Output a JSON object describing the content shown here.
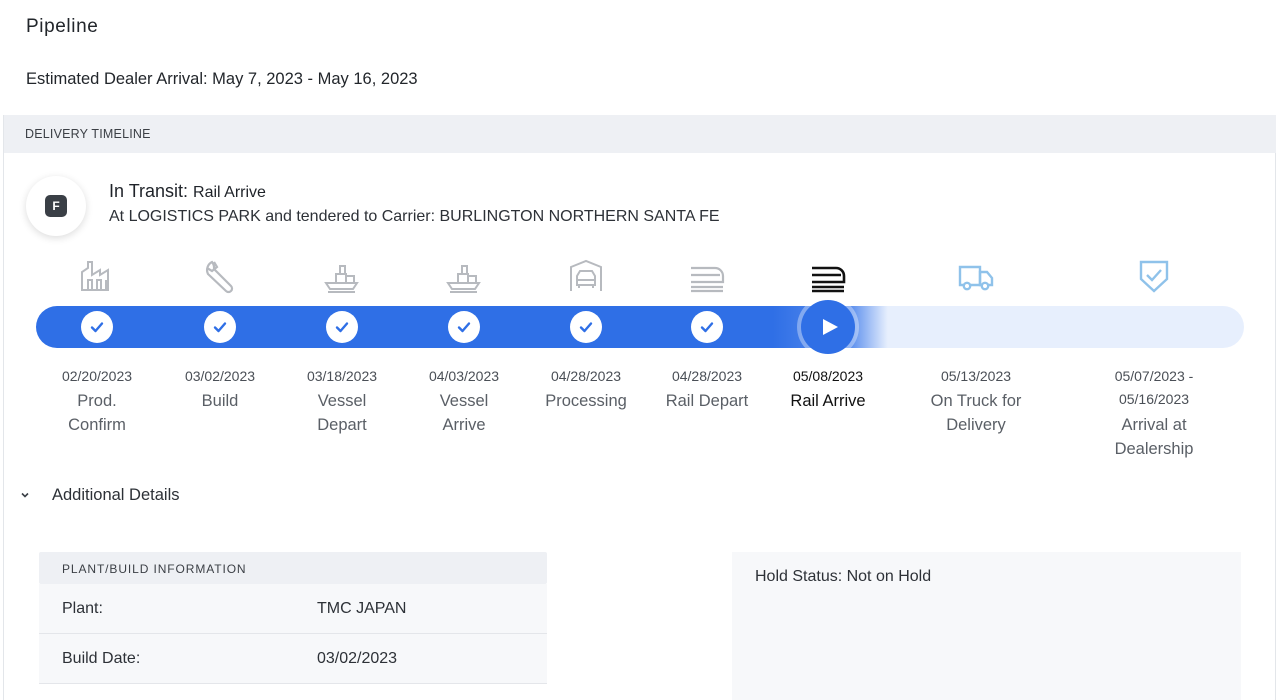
{
  "page": {
    "title": "Pipeline",
    "eta_text": "Estimated Dealer Arrival: May 7, 2023 - May 16, 2023"
  },
  "timeline": {
    "section_title": "DELIVERY TIMELINE",
    "avatar_letter": "F",
    "status_prefix": "In Transit:",
    "status_value": "Rail Arrive",
    "status_detail": "At LOGISTICS PARK and tendered to Carrier: BURLINGTON NORTHERN SANTA FE",
    "steps": [
      {
        "date": "02/20/2023",
        "label": "Prod. Confirm",
        "icon": "factory-icon",
        "state": "done"
      },
      {
        "date": "03/02/2023",
        "label": "Build",
        "icon": "wrench-icon",
        "state": "done"
      },
      {
        "date": "03/18/2023",
        "label": "Vessel Depart",
        "icon": "ship-icon",
        "state": "done"
      },
      {
        "date": "04/03/2023",
        "label": "Vessel Arrive",
        "icon": "ship-icon",
        "state": "done"
      },
      {
        "date": "04/28/2023",
        "label": "Processing",
        "icon": "car-lift-icon",
        "state": "done"
      },
      {
        "date": "04/28/2023",
        "label": "Rail Depart",
        "icon": "train-icon",
        "state": "done"
      },
      {
        "date": "05/08/2023",
        "label": "Rail Arrive",
        "icon": "train-icon",
        "state": "current"
      },
      {
        "date": "05/13/2023",
        "label": "On Truck for Delivery",
        "icon": "truck-icon",
        "state": "pending"
      },
      {
        "date": "05/07/2023 - 05/16/2023",
        "label": "Arrival at Dealership",
        "icon": "shield-check-icon",
        "state": "pending"
      }
    ],
    "colors": {
      "active": "#2f6fe6",
      "inactive": "#e7effd",
      "done_icon": "#b7babf",
      "pending_icon": "#8fc2ea"
    }
  },
  "details": {
    "toggle_label": "Additional Details",
    "plant": {
      "header": "PLANT/BUILD INFORMATION",
      "rows": [
        {
          "label": "Plant:",
          "value": "TMC JAPAN"
        },
        {
          "label": "Build Date:",
          "value": "03/02/2023"
        }
      ]
    },
    "hold_status": "Hold Status: Not on Hold"
  }
}
